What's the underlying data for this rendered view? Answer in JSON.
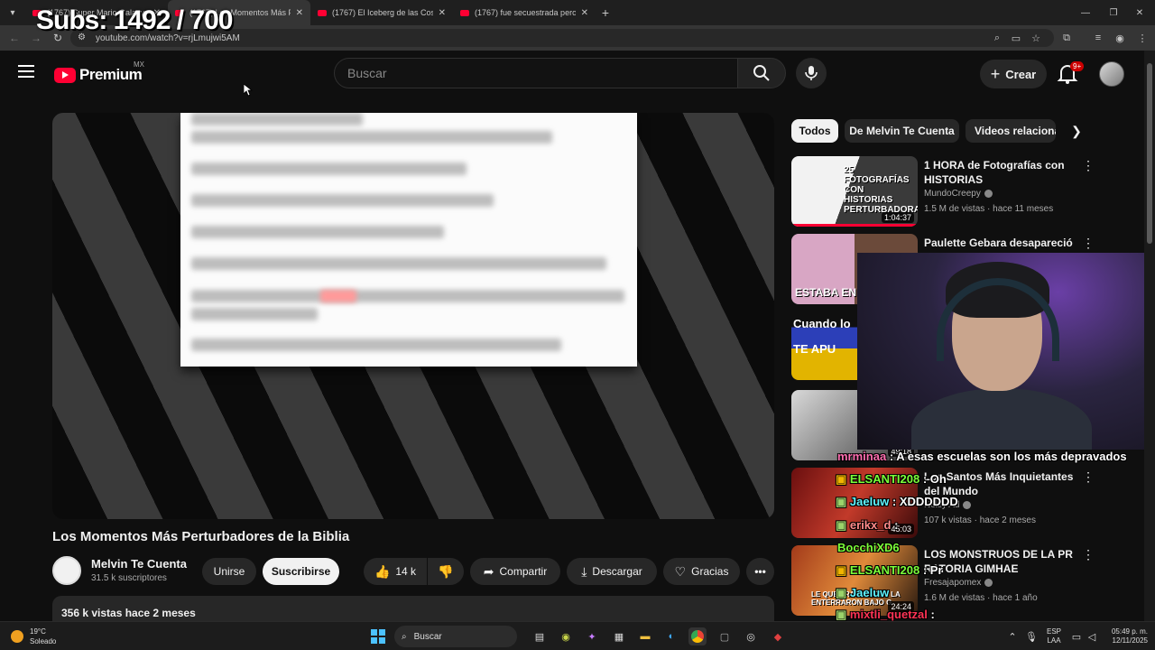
{
  "stream_overlay": {
    "subs_counter": "Subs: 1492 / 700"
  },
  "browser": {
    "tabs": [
      {
        "title": "(1767) Super Mario Galaxy",
        "active": false
      },
      {
        "title": "(1767) Los Momentos Más Pert",
        "active": true
      },
      {
        "title": "(1767) El Iceberg de las Cosas m",
        "active": false
      },
      {
        "title": "(1767) fue secuestrada pero la",
        "active": false
      }
    ],
    "url": "youtube.com/watch?v=rjLmujwi5AM"
  },
  "header": {
    "logo_text": "Premium",
    "region": "MX",
    "search_placeholder": "Buscar",
    "create_label": "Crear",
    "notification_badge": "9+"
  },
  "video": {
    "title": "Los Momentos Más Perturbadores de la Biblia",
    "channel_name": "Melvin Te Cuenta",
    "channel_subs": "31.5 k suscriptores",
    "join_label": "Unirse",
    "subscribe_label": "Suscribirse",
    "likes": "14 k",
    "share_label": "Compartir",
    "download_label": "Descargar",
    "thanks_label": "Gracias",
    "views_date": "356 k vistas  hace 2 meses"
  },
  "sidebar": {
    "chips": [
      "Todos",
      "De Melvin Te Cuenta",
      "Videos relaciona"
    ],
    "recommendations": [
      {
        "title": "1 HORA de Fotografías con HISTORIAS PERTURBADORAS...",
        "channel": "MundoCreepy",
        "meta": "1.5 M de vistas · hace 11 meses",
        "duration": "1:04:37",
        "thumb_text": "25 FOTOGRAFÍAS CON HISTORIAS PERTURBADORAS"
      },
      {
        "title": "Paulette Gebara desapareció",
        "channel": "",
        "meta": "",
        "duration": "",
        "thumb_text": "ESTABA EN"
      },
      {
        "title": "",
        "channel": "",
        "meta": "",
        "duration": "",
        "thumb_text": "Cuando lo  TE APU"
      },
      {
        "title": "",
        "channel": "",
        "meta": "",
        "duration": "49:18",
        "thumb_text": ""
      },
      {
        "title": "Los Santos Más Inquietantes del Mundo",
        "channel": "Noisy Ad",
        "meta": "107 k vistas · hace 2 meses",
        "duration": "45:03",
        "thumb_text": ""
      },
      {
        "title": "LOS MONSTRUOS DE LA PR    RATORIA GIMHAE",
        "channel": "Fresajapomex",
        "meta": "1.6 M de vistas · hace 1 año",
        "duration": "24:24",
        "thumb_text": "LE QUE TRANSMITE Y LA ENTERRARON BAJO G"
      }
    ]
  },
  "chat": [
    {
      "user": "mrminaa",
      "message": " : A esas escuelas son los más depravados",
      "color": "#ff6fb1"
    },
    {
      "user": "ELSANTI208",
      "message": " : Oh",
      "color": "#7cff3a"
    },
    {
      "user": "Jaeluw",
      "message": " : XDDDDDD",
      "color": "#5ff5ff"
    },
    {
      "user": "erikx_d",
      "message": " : ",
      "color": "#ff8a8a"
    },
    {
      "user": "BocchiXD6",
      "message": "",
      "color": "#7cff3a"
    },
    {
      "user": "ELSANTI208",
      "message": " : Pr",
      "color": "#7cff3a"
    },
    {
      "user": "Jaeluw",
      "message": "",
      "color": "#5ff5ff"
    },
    {
      "user": "mixtli_quetzal",
      "message": " : ",
      "color": "#ff3355"
    }
  ],
  "taskbar": {
    "temp": "19°C",
    "condition": "Soleado",
    "search_label": "Buscar",
    "lang_top": "ESP",
    "lang_bottom": "LAA",
    "time": "05:49 p. m.",
    "date": "12/11/2025"
  },
  "colors": {
    "youtube_red": "#ff0033",
    "background": "#0f0f0f",
    "pill": "#272727"
  }
}
